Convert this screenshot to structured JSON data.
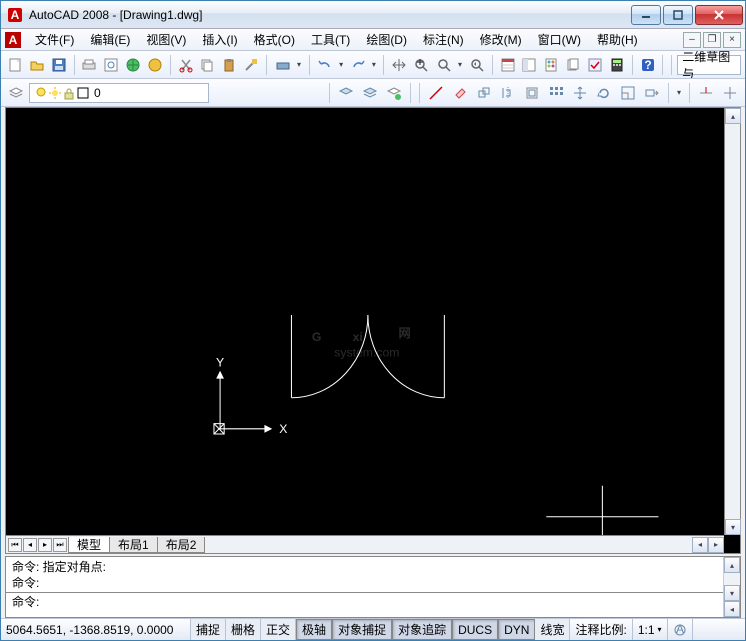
{
  "window": {
    "title": "AutoCAD 2008 - [Drawing1.dwg]"
  },
  "menubar": {
    "items": [
      "文件(F)",
      "编辑(E)",
      "视图(V)",
      "插入(I)",
      "格式(O)",
      "工具(T)",
      "绘图(D)",
      "标注(N)",
      "修改(M)",
      "窗口(W)",
      "帮助(H)"
    ]
  },
  "toolbar1": {
    "trailing_label": "二维草图与"
  },
  "toolbar2": {
    "layer_value": "0"
  },
  "tabs": {
    "items": [
      "模型",
      "布局1",
      "布局2"
    ],
    "active": 0
  },
  "cmd": {
    "line1": "命令: 指定对角点:",
    "line2": "命令:",
    "input_label": "命令:"
  },
  "status": {
    "coords": "5064.5651, -1368.8519, 0.0000",
    "toggles": [
      "捕捉",
      "栅格",
      "正交",
      "极轴",
      "对象捕捉",
      "对象追踪",
      "DUCS",
      "DYN",
      "线宽"
    ],
    "pressed": [
      3,
      4,
      5,
      6,
      7
    ],
    "anno_label": "注释比例:",
    "anno_value": "1:1"
  },
  "watermark": {
    "g": "G",
    "xi": "xi",
    "net": "网",
    "sub": "system.com"
  },
  "ucs": {
    "x": "X",
    "y": "Y"
  }
}
